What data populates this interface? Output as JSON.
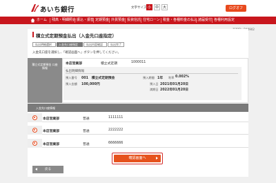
{
  "header": {
    "logo_text": "あいち銀行",
    "font_size_label": "文字サイズ変更",
    "font_sizes": [
      "小",
      "中",
      "大"
    ],
    "font_size_active": "小",
    "logout_label": "ログオフ"
  },
  "nav": {
    "items": [
      "ホーム",
      "残高・明細照会",
      "振込・振替",
      "定期預金",
      "外貨預金",
      "投資信託",
      "住宅ローン",
      "税金・各種料金の払込",
      "諸届受付",
      "各種利用設定"
    ]
  },
  "page": {
    "screen_id": "画面ID：BA0902",
    "title": "積立式定期預金払出（入金先口座指定）",
    "steps": [
      "払出明細選択",
      "入金先口座指定",
      "払出内容確認",
      "払出完了"
    ],
    "current_step": "入金先口座指定",
    "instruction": "入金先口座を選択し、「確認画面へ」ボタンを押してください。"
  },
  "source_account": {
    "label": "積立式定期預金\n口座情報",
    "branch": "本店営業部",
    "type": "積立式定期",
    "number": "1000011",
    "detail_heading": "払出明細情報",
    "deposit_no_label": "預入番号",
    "deposit_no_value": "001　積立式定期預金",
    "period_label": "預入期間",
    "period_value": "1年",
    "rate_label": "利率",
    "rate_value": "0.002%",
    "amount_label": "預入金額",
    "amount_value": "100,000円",
    "deposit_date_label": "預入日",
    "deposit_date_value": "2021年01月20日",
    "maturity_label": "満期日",
    "maturity_value": "2022年01月20日"
  },
  "destination": {
    "label": "入金先口座情報",
    "accounts": [
      {
        "branch": "本店営業部",
        "type": "普通",
        "number": "1111111"
      },
      {
        "branch": "本店営業部",
        "type": "普通",
        "number": "2222222"
      },
      {
        "branch": "本店営業部",
        "type": "普通",
        "number": "6666666"
      }
    ]
  },
  "actions": {
    "confirm_label": "確認画面へ",
    "back_label": "戻る"
  },
  "colors": {
    "brand_red": "#c8161d",
    "accent_orange": "#e6521d"
  }
}
